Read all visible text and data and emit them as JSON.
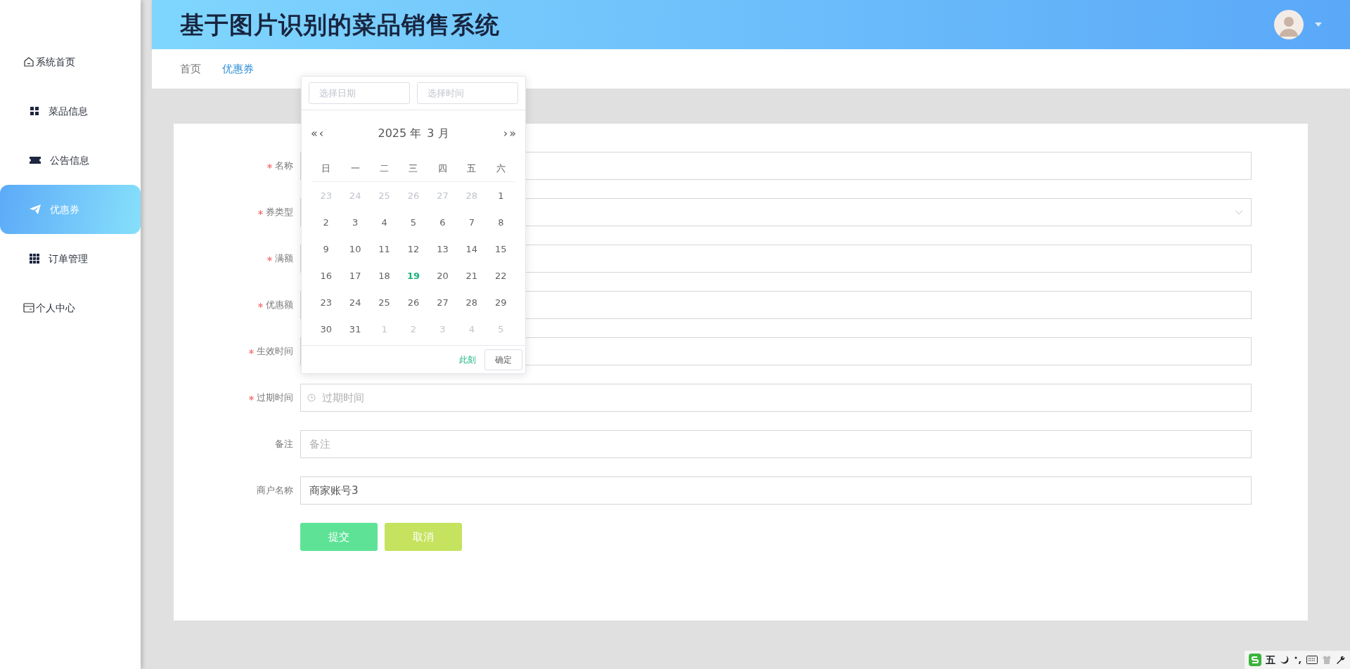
{
  "sidebar": {
    "items": [
      {
        "label": "系统首页",
        "selected": false
      },
      {
        "label": "菜品信息",
        "selected": false
      },
      {
        "label": "公告信息",
        "selected": false
      },
      {
        "label": "优惠券",
        "selected": true
      },
      {
        "label": "订单管理",
        "selected": false
      },
      {
        "label": "个人中心",
        "selected": false
      }
    ]
  },
  "header": {
    "title": "基于图片识别的菜品销售系统"
  },
  "breadcrumb": [
    {
      "label": "首页",
      "selected": false
    },
    {
      "label": "优惠券",
      "selected": true
    }
  ],
  "form": {
    "fields": [
      {
        "label": "名称",
        "required": true,
        "kind": "text"
      },
      {
        "label": "券类型",
        "required": true,
        "kind": "select"
      },
      {
        "label": "满额",
        "required": true,
        "kind": "text"
      },
      {
        "label": "优惠额",
        "required": true,
        "kind": "text"
      },
      {
        "label": "生效时间",
        "required": true,
        "kind": "text"
      },
      {
        "label": "过期时间",
        "required": true,
        "kind": "datetime",
        "placeholder": "过期时间"
      },
      {
        "label": "备注",
        "required": false,
        "kind": "text",
        "placeholder": "备注"
      },
      {
        "label": "商户名称",
        "required": false,
        "kind": "text",
        "value": "商家账号3"
      }
    ],
    "buttons": [
      {
        "label": "提交",
        "kind": "submit"
      },
      {
        "label": "取消",
        "kind": "cancel"
      }
    ]
  },
  "date_picker": {
    "date_placeholder": "选择日期",
    "time_placeholder": "选择时间",
    "year": "2025 年",
    "month": "3 月",
    "prev_year": "«",
    "prev_month": "‹",
    "next_month": "›",
    "next_year": "»",
    "weekdays": [
      "日",
      "一",
      "二",
      "三",
      "四",
      "五",
      "六"
    ],
    "weeks": [
      [
        {
          "day": "23",
          "other_month": true
        },
        {
          "day": "24",
          "other_month": true
        },
        {
          "day": "25",
          "other_month": true
        },
        {
          "day": "26",
          "other_month": true
        },
        {
          "day": "27",
          "other_month": true
        },
        {
          "day": "28",
          "other_month": true
        },
        {
          "day": "1",
          "other_month": false
        }
      ],
      [
        {
          "day": "2",
          "other_month": false
        },
        {
          "day": "3",
          "other_month": false
        },
        {
          "day": "4",
          "other_month": false
        },
        {
          "day": "5",
          "other_month": false
        },
        {
          "day": "6",
          "other_month": false
        },
        {
          "day": "7",
          "other_month": false
        },
        {
          "day": "8",
          "other_month": false
        }
      ],
      [
        {
          "day": "9",
          "other_month": false
        },
        {
          "day": "10",
          "other_month": false
        },
        {
          "day": "11",
          "other_month": false
        },
        {
          "day": "12",
          "other_month": false
        },
        {
          "day": "13",
          "other_month": false
        },
        {
          "day": "14",
          "other_month": false
        },
        {
          "day": "15",
          "other_month": false
        }
      ],
      [
        {
          "day": "16",
          "other_month": false
        },
        {
          "day": "17",
          "other_month": false
        },
        {
          "day": "18",
          "other_month": false
        },
        {
          "day": "19",
          "other_month": false,
          "today": true
        },
        {
          "day": "20",
          "other_month": false
        },
        {
          "day": "21",
          "other_month": false
        },
        {
          "day": "22",
          "other_month": false
        }
      ],
      [
        {
          "day": "23",
          "other_month": false
        },
        {
          "day": "24",
          "other_month": false
        },
        {
          "day": "25",
          "other_month": false
        },
        {
          "day": "26",
          "other_month": false
        },
        {
          "day": "27",
          "other_month": false
        },
        {
          "day": "28",
          "other_month": false
        },
        {
          "day": "29",
          "other_month": false
        }
      ],
      [
        {
          "day": "30",
          "other_month": false
        },
        {
          "day": "31",
          "other_month": false
        },
        {
          "day": "1",
          "other_month": true
        },
        {
          "day": "2",
          "other_month": true
        },
        {
          "day": "3",
          "other_month": true
        },
        {
          "day": "4",
          "other_month": true
        },
        {
          "day": "5",
          "other_month": true
        }
      ]
    ],
    "now_link": "此刻",
    "confirm": "确定"
  },
  "ime_bar": {
    "mode": "五"
  }
}
